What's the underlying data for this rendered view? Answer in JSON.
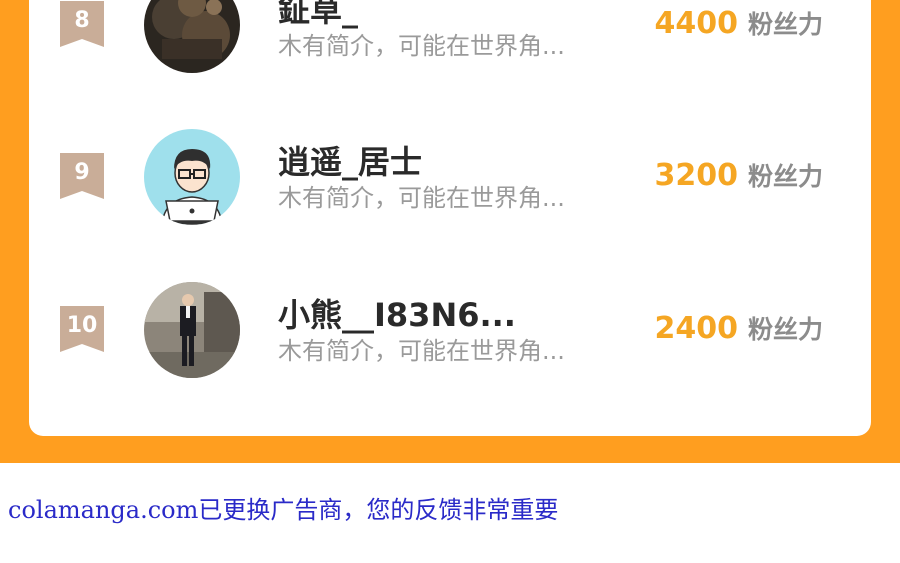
{
  "ranking": {
    "rows": [
      {
        "rank": "8",
        "username": "鉦草_",
        "bio": "木有简介，可能在世界角...",
        "fans_count": "4400",
        "fans_unit": "粉丝力"
      },
      {
        "rank": "9",
        "username": "逍遥_居士",
        "bio": "木有简介，可能在世界角...",
        "fans_count": "3200",
        "fans_unit": "粉丝力"
      },
      {
        "rank": "10",
        "username": "小熊__I83N6...",
        "bio": "木有简介，可能在世界角...",
        "fans_count": "2400",
        "fans_unit": "粉丝力"
      }
    ]
  },
  "footer": {
    "notice": "colamanga.com已更换广告商，您的反馈非常重要"
  },
  "colors": {
    "panel_orange": "#ff9e1f",
    "fans_count": "#f5a623",
    "rank_badge": "#c9ad98",
    "notice_blue": "#2a2ac8"
  }
}
